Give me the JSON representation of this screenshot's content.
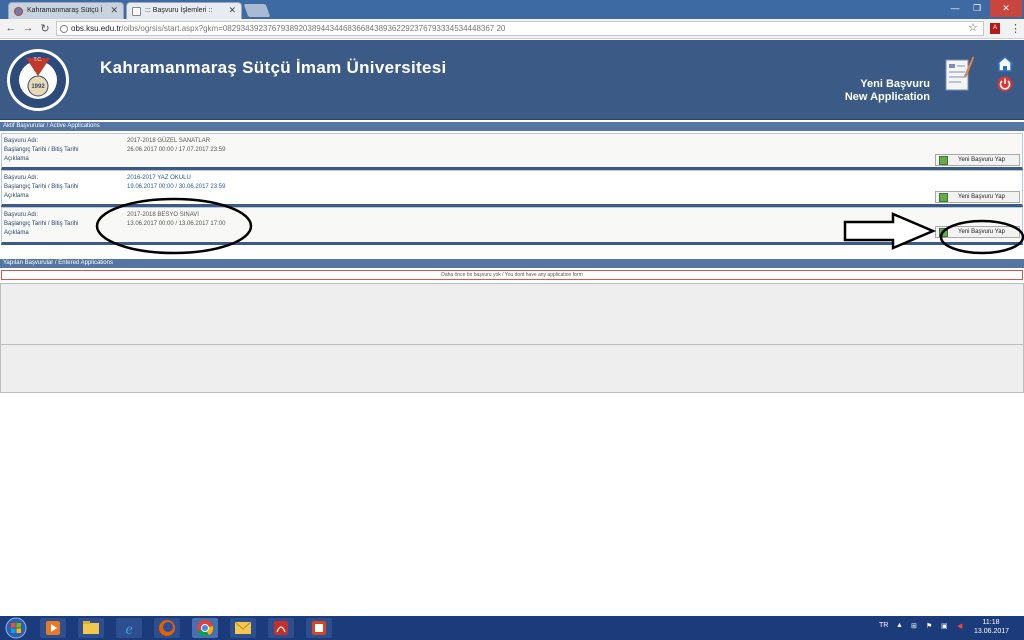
{
  "browser": {
    "tabs": [
      {
        "title": "Kahramanmaraş Sütçü İ"
      },
      {
        "title": "::: Başvuru İşlemleri ::"
      }
    ],
    "address": {
      "host": "obs.ksu.edu.tr",
      "path": "/oibs/ogrsis/start.aspx?gkm=0829343923767938920389443446836684389362292376793334534448367 20"
    }
  },
  "site": {
    "title": "Kahramanmaraş Sütçü İmam Üniversitesi",
    "logo_year": "1992",
    "logo_tc": "T.C.",
    "new_application_tr": "Yeni Başvuru",
    "new_application_en": "New Application"
  },
  "active_section": {
    "title": "Aktif Başvurular / Active Applications"
  },
  "applications": [
    {
      "name_label": "Başvuru Adı:",
      "date_label": "Başlangıç Tarihi / Bitiş Tarihi",
      "desc_label": "Açıklama",
      "name": "2017-2018 GÜZEL SANATLAR",
      "dates": "26.06.2017 00:00  /  17.07.2017 23:59",
      "button": "Yeni Başvuru Yap"
    },
    {
      "name_label": "Başvuru Adı:",
      "date_label": "Başlangıç Tarihi / Bitiş Tarihi",
      "desc_label": "Açıklama",
      "name": "2016-2017 YAZ OKULU",
      "dates": "19.06.2017 00:00  /  30.06.2017 23:59",
      "button": "Yeni Başvuru Yap"
    },
    {
      "name_label": "Başvuru Adı:",
      "date_label": "Başlangıç Tarihi / Bitiş Tarihi",
      "desc_label": "Açıklama",
      "name": "2017-2018 BESYO SINAVI",
      "dates": "13.06.2017 00:00  /  13.06.2017 17:00",
      "button": "Yeni Başvuru Yap"
    }
  ],
  "entered_section": {
    "title": "Yapılan Başvurular / Entered Applications",
    "empty_message": "Daha önce bir başvuru yok / You dont have any application form"
  },
  "taskbar": {
    "lang": "TR",
    "time": "11:18",
    "date": "13.06.2017"
  },
  "colors": {
    "header": "#3b5b86",
    "section_bar": "#5576a3",
    "taskbar": "#1b3b7a"
  }
}
